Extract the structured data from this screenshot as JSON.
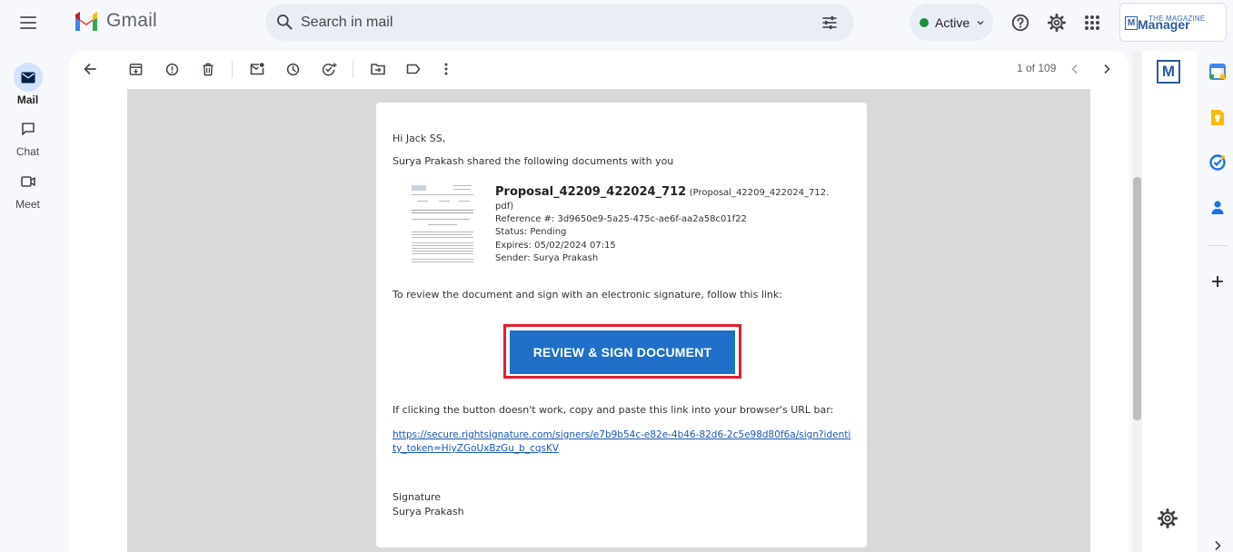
{
  "app": {
    "name": "Gmail",
    "search_placeholder": "Search in mail",
    "status_label": "Active"
  },
  "addon": {
    "small": "THE MAGAZINE",
    "big": "Manager",
    "badge": "M"
  },
  "nav": {
    "items": [
      {
        "label": "Mail",
        "icon": "mail-icon",
        "active": true
      },
      {
        "label": "Chat",
        "icon": "chat-icon",
        "active": false
      },
      {
        "label": "Meet",
        "icon": "meet-icon",
        "active": false
      }
    ]
  },
  "toolbar": {
    "page_count": "1 of 109"
  },
  "email": {
    "greeting": "Hi Jack SS,",
    "intro": "Surya Prakash shared the following documents with you",
    "doc_title": "Proposal_42209_422024_712",
    "doc_file_1": "(Proposal_42209_422024_712.",
    "doc_file_2": "pdf)",
    "reference": "Reference #: 3d9650e9-5a25-475c-ae6f-aa2a58c01f22",
    "status": "Status: Pending",
    "expires": "Expires: 05/02/2024 07:15",
    "sender": "Sender: Surya Prakash",
    "review_text": "To review the document and sign with an electronic signature, follow this link:",
    "cta_label": "REVIEW & SIGN DOCUMENT",
    "fallback_text": "If clicking the button doesn't work, copy and paste this link into your browser's URL bar:",
    "link_text": "https://secure.rightsignature.com/signers/e7b9b54c-e82e-4b46-82d6-2c5e98d80f6a/sign?identity_token=HiyZGoUxBzGu_b_cqsKV",
    "signature_label": "Signature",
    "signature_name": "Surya Prakash"
  },
  "colors": {
    "accent": "#0b57d0",
    "cta": "#1f6fc8",
    "highlight": "#e0202d",
    "active_dot": "#1e8e3e"
  }
}
